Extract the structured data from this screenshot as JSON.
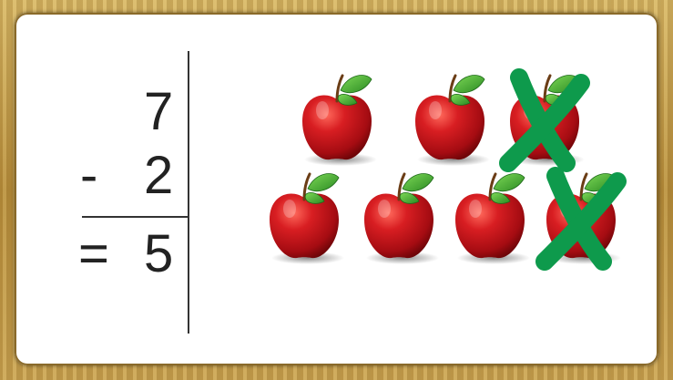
{
  "equation": {
    "minuend": "7",
    "operator": "-",
    "subtrahend": "2",
    "equals": "=",
    "result": "5"
  },
  "apples": [
    {
      "row": 1,
      "crossed": false
    },
    {
      "row": 1,
      "crossed": false
    },
    {
      "row": 1,
      "crossed": true
    },
    {
      "row": 2,
      "crossed": false
    },
    {
      "row": 2,
      "crossed": false
    },
    {
      "row": 2,
      "crossed": false
    },
    {
      "row": 2,
      "crossed": true
    }
  ],
  "icons": [
    "apple-icon",
    "cross-mark-icon"
  ],
  "colors": {
    "apple": "#c0141a",
    "leaf": "#3aa12e",
    "cross": "#0e9a4c",
    "frame": "#c9a55a"
  }
}
